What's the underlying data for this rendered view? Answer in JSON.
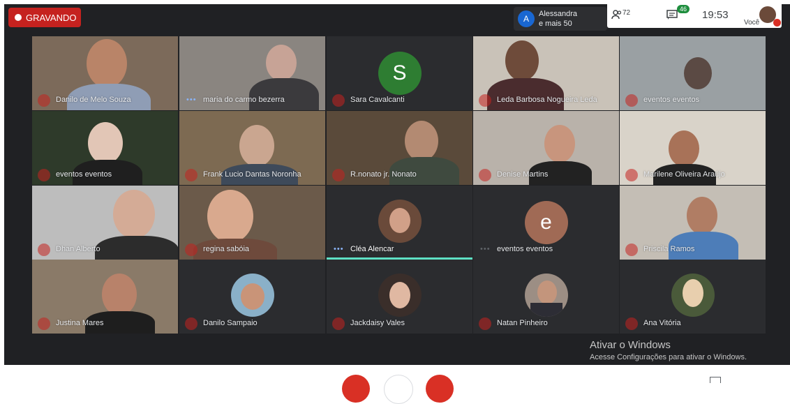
{
  "recording": {
    "label": "GRAVANDO"
  },
  "presenter": {
    "avatar_letter": "A",
    "line1": "Alessandra",
    "line2": "e mais 50"
  },
  "topbar": {
    "participants_count": "72",
    "chat_badge": "46",
    "time": "19:53",
    "self_label": "Você"
  },
  "tiles": [
    {
      "name": "Danilo de Melo Souza",
      "state": "muted"
    },
    {
      "name": "maria do carmo bezerra",
      "state": "dots"
    },
    {
      "name": "Sara Cavalcanti",
      "state": "muted",
      "letter": "S",
      "letter_color": "#2e7d32"
    },
    {
      "name": "Leda Barbosa Nogueira Leda",
      "state": "muted"
    },
    {
      "name": "eventos eventos",
      "state": "muted"
    },
    {
      "name": "eventos eventos",
      "state": "muted"
    },
    {
      "name": "Frank Lucio Dantas Noronha",
      "state": "muted"
    },
    {
      "name": "R.nonato jr. Nonato",
      "state": "muted"
    },
    {
      "name": "Denise Martins",
      "state": "muted"
    },
    {
      "name": "Marilene Oliveira Araújo",
      "state": "muted"
    },
    {
      "name": "Dhan Alberto",
      "state": "muted"
    },
    {
      "name": "regina sabóia",
      "state": "muted"
    },
    {
      "name": "Cléa Alencar",
      "state": "dots",
      "speaking": true
    },
    {
      "name": "eventos eventos",
      "state": "dots",
      "letter": "e",
      "letter_color": "#a06a55"
    },
    {
      "name": "Priscila Ramos",
      "state": "muted"
    },
    {
      "name": "Justina Mares",
      "state": "muted"
    },
    {
      "name": "Danilo Sampaio",
      "state": "muted"
    },
    {
      "name": "Jackdaisy Vales",
      "state": "muted"
    },
    {
      "name": "Natan Pinheiro",
      "state": "muted"
    },
    {
      "name": "Ana Vitória",
      "state": "muted"
    }
  ],
  "watermark": {
    "title": "Ativar o Windows",
    "subtitle": "Acesse Configurações para ativar o Windows."
  },
  "colors": {
    "recording": "#c5221f",
    "speaking_bar": "#5ee0c4",
    "stage": "#202124"
  }
}
